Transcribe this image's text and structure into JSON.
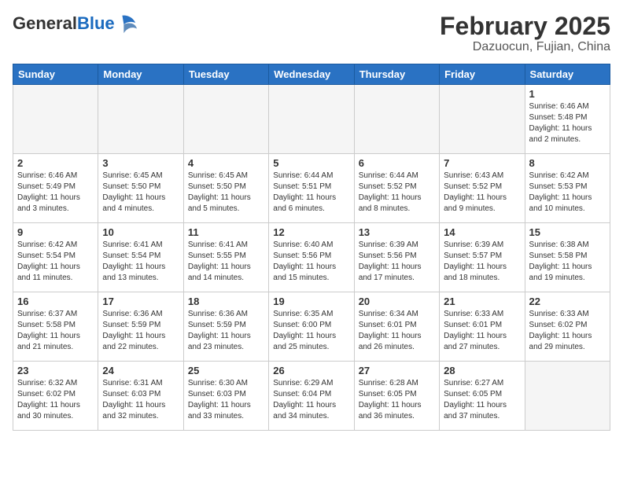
{
  "header": {
    "logo_general": "General",
    "logo_blue": "Blue",
    "month_title": "February 2025",
    "subtitle": "Dazuocun, Fujian, China"
  },
  "days_of_week": [
    "Sunday",
    "Monday",
    "Tuesday",
    "Wednesday",
    "Thursday",
    "Friday",
    "Saturday"
  ],
  "weeks": [
    [
      {
        "day": "",
        "info": ""
      },
      {
        "day": "",
        "info": ""
      },
      {
        "day": "",
        "info": ""
      },
      {
        "day": "",
        "info": ""
      },
      {
        "day": "",
        "info": ""
      },
      {
        "day": "",
        "info": ""
      },
      {
        "day": "1",
        "info": "Sunrise: 6:46 AM\nSunset: 5:48 PM\nDaylight: 11 hours and 2 minutes."
      }
    ],
    [
      {
        "day": "2",
        "info": "Sunrise: 6:46 AM\nSunset: 5:49 PM\nDaylight: 11 hours and 3 minutes."
      },
      {
        "day": "3",
        "info": "Sunrise: 6:45 AM\nSunset: 5:50 PM\nDaylight: 11 hours and 4 minutes."
      },
      {
        "day": "4",
        "info": "Sunrise: 6:45 AM\nSunset: 5:50 PM\nDaylight: 11 hours and 5 minutes."
      },
      {
        "day": "5",
        "info": "Sunrise: 6:44 AM\nSunset: 5:51 PM\nDaylight: 11 hours and 6 minutes."
      },
      {
        "day": "6",
        "info": "Sunrise: 6:44 AM\nSunset: 5:52 PM\nDaylight: 11 hours and 8 minutes."
      },
      {
        "day": "7",
        "info": "Sunrise: 6:43 AM\nSunset: 5:52 PM\nDaylight: 11 hours and 9 minutes."
      },
      {
        "day": "8",
        "info": "Sunrise: 6:42 AM\nSunset: 5:53 PM\nDaylight: 11 hours and 10 minutes."
      }
    ],
    [
      {
        "day": "9",
        "info": "Sunrise: 6:42 AM\nSunset: 5:54 PM\nDaylight: 11 hours and 11 minutes."
      },
      {
        "day": "10",
        "info": "Sunrise: 6:41 AM\nSunset: 5:54 PM\nDaylight: 11 hours and 13 minutes."
      },
      {
        "day": "11",
        "info": "Sunrise: 6:41 AM\nSunset: 5:55 PM\nDaylight: 11 hours and 14 minutes."
      },
      {
        "day": "12",
        "info": "Sunrise: 6:40 AM\nSunset: 5:56 PM\nDaylight: 11 hours and 15 minutes."
      },
      {
        "day": "13",
        "info": "Sunrise: 6:39 AM\nSunset: 5:56 PM\nDaylight: 11 hours and 17 minutes."
      },
      {
        "day": "14",
        "info": "Sunrise: 6:39 AM\nSunset: 5:57 PM\nDaylight: 11 hours and 18 minutes."
      },
      {
        "day": "15",
        "info": "Sunrise: 6:38 AM\nSunset: 5:58 PM\nDaylight: 11 hours and 19 minutes."
      }
    ],
    [
      {
        "day": "16",
        "info": "Sunrise: 6:37 AM\nSunset: 5:58 PM\nDaylight: 11 hours and 21 minutes."
      },
      {
        "day": "17",
        "info": "Sunrise: 6:36 AM\nSunset: 5:59 PM\nDaylight: 11 hours and 22 minutes."
      },
      {
        "day": "18",
        "info": "Sunrise: 6:36 AM\nSunset: 5:59 PM\nDaylight: 11 hours and 23 minutes."
      },
      {
        "day": "19",
        "info": "Sunrise: 6:35 AM\nSunset: 6:00 PM\nDaylight: 11 hours and 25 minutes."
      },
      {
        "day": "20",
        "info": "Sunrise: 6:34 AM\nSunset: 6:01 PM\nDaylight: 11 hours and 26 minutes."
      },
      {
        "day": "21",
        "info": "Sunrise: 6:33 AM\nSunset: 6:01 PM\nDaylight: 11 hours and 27 minutes."
      },
      {
        "day": "22",
        "info": "Sunrise: 6:33 AM\nSunset: 6:02 PM\nDaylight: 11 hours and 29 minutes."
      }
    ],
    [
      {
        "day": "23",
        "info": "Sunrise: 6:32 AM\nSunset: 6:02 PM\nDaylight: 11 hours and 30 minutes."
      },
      {
        "day": "24",
        "info": "Sunrise: 6:31 AM\nSunset: 6:03 PM\nDaylight: 11 hours and 32 minutes."
      },
      {
        "day": "25",
        "info": "Sunrise: 6:30 AM\nSunset: 6:03 PM\nDaylight: 11 hours and 33 minutes."
      },
      {
        "day": "26",
        "info": "Sunrise: 6:29 AM\nSunset: 6:04 PM\nDaylight: 11 hours and 34 minutes."
      },
      {
        "day": "27",
        "info": "Sunrise: 6:28 AM\nSunset: 6:05 PM\nDaylight: 11 hours and 36 minutes."
      },
      {
        "day": "28",
        "info": "Sunrise: 6:27 AM\nSunset: 6:05 PM\nDaylight: 11 hours and 37 minutes."
      },
      {
        "day": "",
        "info": ""
      }
    ]
  ]
}
